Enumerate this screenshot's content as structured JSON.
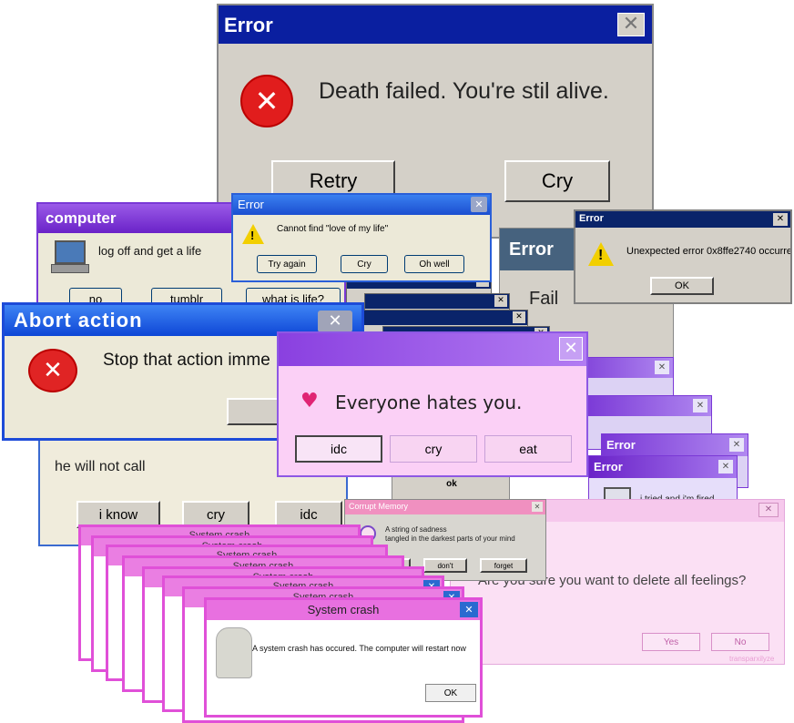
{
  "colors": {
    "xp_blue": "#0a246a",
    "purple_title": "#7a38d6",
    "pink_bg": "#f8ccf4",
    "pink_border": "#e060d8",
    "win98_gray": "#d4d0c8"
  },
  "death_dialog": {
    "title": "Error",
    "message": "Death failed. You're stil alive.",
    "icon": "error-x-icon",
    "buttons": [
      "Retry",
      "Cry"
    ]
  },
  "computer_dialog": {
    "title": "computer",
    "message": "log off and get a life",
    "icon": "computer-icon",
    "buttons": [
      "no",
      "tumblr",
      "what is life?"
    ]
  },
  "love_dialog": {
    "title": "Error",
    "message": "Cannot find \"love of my life\"",
    "icon": "warning-icon",
    "buttons": [
      "Try again",
      "Cry",
      "Oh well"
    ]
  },
  "unexpected_dialog": {
    "title": "Error",
    "message": "Unexpected error 0x8ffe2740 occurred.",
    "icon": "warning-icon",
    "ok": "OK"
  },
  "fail_dialog": {
    "title": "Error",
    "message": "Fail"
  },
  "abort_dialog": {
    "title": "Abort action",
    "message": "Stop that action imme",
    "icon": "error-x-icon",
    "button": "O"
  },
  "call_dialog": {
    "message": "he will not call",
    "buttons": [
      "i know",
      "cry",
      "idc"
    ]
  },
  "hates_dialog": {
    "message": "Everyone hates you.",
    "icon": "pixel-heart-icon",
    "buttons": [
      "idc",
      "cry",
      "eat"
    ]
  },
  "hidden_ok": "ok",
  "fired_stack": {
    "titles": [
      "Error",
      "Error"
    ],
    "message": "i tried and i'm fired.",
    "icon": "floppy-disk-icon"
  },
  "corrupt_dialog": {
    "title": "Corrupt Memory",
    "line1": "A string of sadness",
    "line2": "tangled in the darkest parts of your mind",
    "icon": "magnifier-icon",
    "buttons": [
      "please",
      "don't",
      "forget"
    ]
  },
  "feelings_dialog": {
    "message": "Are you sure you want to delete all feelings?",
    "buttons": [
      "Yes",
      "No"
    ],
    "watermark": "transparxilyze"
  },
  "crash_stack": {
    "back_title": "System crash",
    "title": "System crash",
    "message": "A system crash has occured. The computer will restart now",
    "ok": "OK",
    "icon": "statue-icon"
  }
}
